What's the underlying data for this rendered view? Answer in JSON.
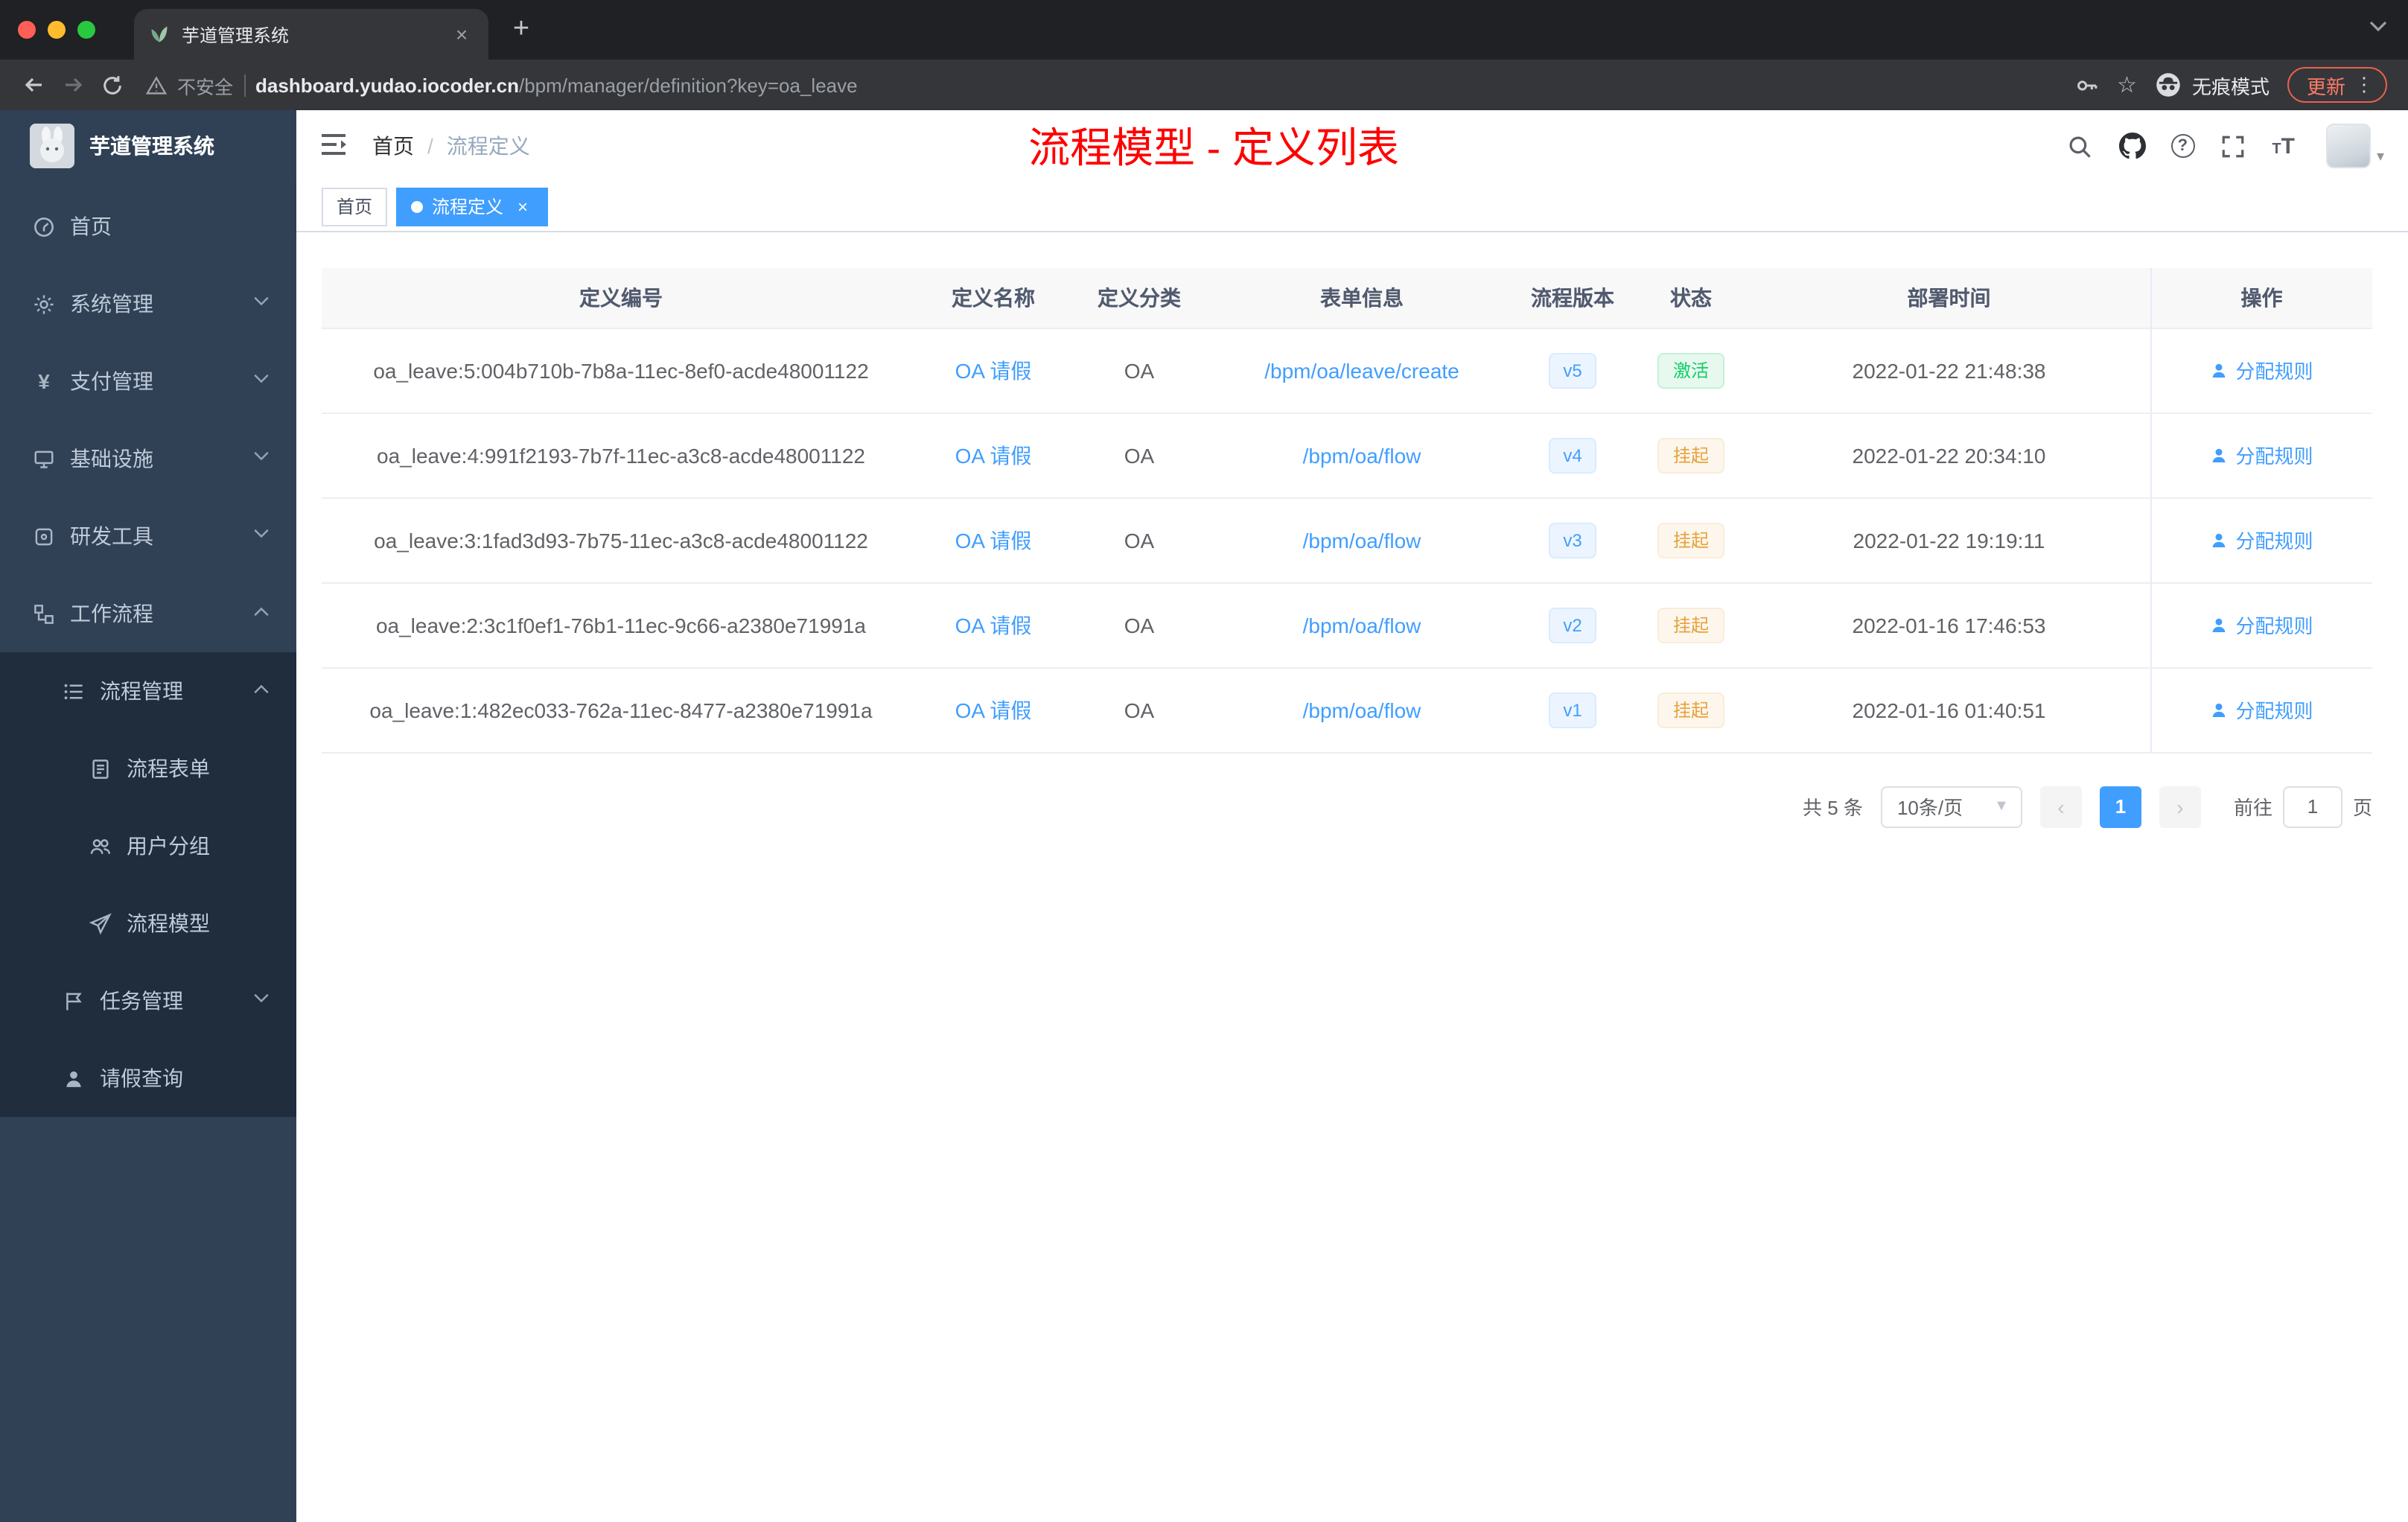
{
  "browser": {
    "tab_title": "芋道管理系统",
    "security_label": "不安全",
    "url_domain": "dashboard.yudao.iocoder.cn",
    "url_path": "/bpm/manager/definition?key=oa_leave",
    "incognito_label": "无痕模式",
    "update_label": "更新"
  },
  "sidebar": {
    "logo_title": "芋道管理系统",
    "items": [
      {
        "label": "首页"
      },
      {
        "label": "系统管理"
      },
      {
        "label": "支付管理"
      },
      {
        "label": "基础设施"
      },
      {
        "label": "研发工具"
      },
      {
        "label": "工作流程"
      },
      {
        "label": "流程管理"
      },
      {
        "label": "流程表单"
      },
      {
        "label": "用户分组"
      },
      {
        "label": "流程模型"
      },
      {
        "label": "任务管理"
      },
      {
        "label": "请假查询"
      }
    ]
  },
  "header": {
    "breadcrumb": {
      "home": "首页",
      "current": "流程定义"
    },
    "annotation": "流程模型 - 定义列表"
  },
  "tags": {
    "home": "首页",
    "current": "流程定义"
  },
  "table": {
    "columns": {
      "id": "定义编号",
      "name": "定义名称",
      "category": "定义分类",
      "form": "表单信息",
      "version": "流程版本",
      "status": "状态",
      "deploy_time": "部署时间",
      "actions": "操作"
    },
    "rows": [
      {
        "id": "oa_leave:5:004b710b-7b8a-11ec-8ef0-acde48001122",
        "name": "OA 请假",
        "category": "OA",
        "form": "/bpm/oa/leave/create",
        "version": "v5",
        "status": "激活",
        "status_type": "active",
        "deploy_time": "2022-01-22 21:48:38",
        "action": "分配规则"
      },
      {
        "id": "oa_leave:4:991f2193-7b7f-11ec-a3c8-acde48001122",
        "name": "OA 请假",
        "category": "OA",
        "form": "/bpm/oa/flow",
        "version": "v4",
        "status": "挂起",
        "status_type": "suspended",
        "deploy_time": "2022-01-22 20:34:10",
        "action": "分配规则"
      },
      {
        "id": "oa_leave:3:1fad3d93-7b75-11ec-a3c8-acde48001122",
        "name": "OA 请假",
        "category": "OA",
        "form": "/bpm/oa/flow",
        "version": "v3",
        "status": "挂起",
        "status_type": "suspended",
        "deploy_time": "2022-01-22 19:19:11",
        "action": "分配规则"
      },
      {
        "id": "oa_leave:2:3c1f0ef1-76b1-11ec-9c66-a2380e71991a",
        "name": "OA 请假",
        "category": "OA",
        "form": "/bpm/oa/flow",
        "version": "v2",
        "status": "挂起",
        "status_type": "suspended",
        "deploy_time": "2022-01-16 17:46:53",
        "action": "分配规则"
      },
      {
        "id": "oa_leave:1:482ec033-762a-11ec-8477-a2380e71991a",
        "name": "OA 请假",
        "category": "OA",
        "form": "/bpm/oa/flow",
        "version": "v1",
        "status": "挂起",
        "status_type": "suspended",
        "deploy_time": "2022-01-16 01:40:51",
        "action": "分配规则"
      }
    ]
  },
  "pagination": {
    "total": "共 5 条",
    "page_size": "10条/页",
    "current_page": "1",
    "goto_label": "前往",
    "goto_value": "1",
    "page_unit": "页"
  },
  "colors": {
    "accent": "#409eff",
    "annotation_red": "#ff0000",
    "sidebar_bg": "#304156",
    "submenu_bg": "#1f2d3d",
    "success_text": "#13ce66",
    "warning_text": "#e6a23c"
  }
}
